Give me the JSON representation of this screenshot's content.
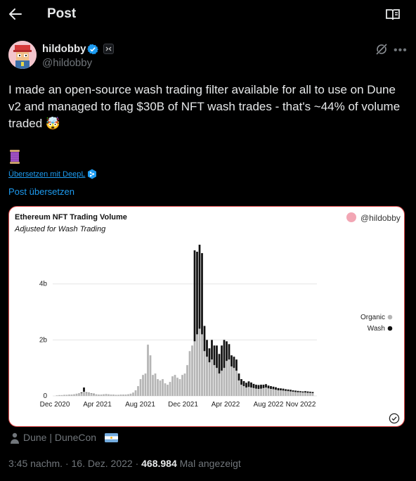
{
  "header": {
    "title": "Post"
  },
  "author": {
    "name": "hildobby",
    "handle": "@hildobby"
  },
  "tweet": {
    "text": "I made an open-source wash trading filter available for all to use on Dune v2 and managed to flag $30B of NFT wash trades - that's ~44% of volume traded 🤯",
    "deepl_link": "Übersetzen mit DeepL",
    "translate_link": "Post übersetzen"
  },
  "card": {
    "handle": "@hildobby"
  },
  "chart_data": {
    "type": "bar",
    "title": "Ethereum NFT Trading Volume",
    "subtitle": "Adjusted for Wash Trading",
    "stacked": true,
    "x_tick_labels": [
      "Dec 2020",
      "Apr 2021",
      "Aug 2021",
      "Dec 2021",
      "Apr 2022",
      "Aug 2022",
      "Nov 2022"
    ],
    "y_tick_labels": [
      "0",
      "2b",
      "4b"
    ],
    "ylim": [
      0,
      5500000000
    ],
    "grid": true,
    "legend": {
      "position": "right",
      "entries": [
        "Organic",
        "Wash"
      ]
    },
    "x": [
      "2020-12-07",
      "2020-12-14",
      "2020-12-21",
      "2020-12-28",
      "2021-01-04",
      "2021-01-11",
      "2021-01-18",
      "2021-01-25",
      "2021-02-01",
      "2021-02-08",
      "2021-02-15",
      "2021-02-22",
      "2021-03-01",
      "2021-03-08",
      "2021-03-15",
      "2021-03-22",
      "2021-03-29",
      "2021-04-05",
      "2021-04-12",
      "2021-04-19",
      "2021-04-26",
      "2021-05-03",
      "2021-05-10",
      "2021-05-17",
      "2021-05-24",
      "2021-05-31",
      "2021-06-07",
      "2021-06-14",
      "2021-06-21",
      "2021-06-28",
      "2021-07-05",
      "2021-07-12",
      "2021-07-19",
      "2021-07-26",
      "2021-08-02",
      "2021-08-09",
      "2021-08-16",
      "2021-08-23",
      "2021-08-30",
      "2021-09-06",
      "2021-09-13",
      "2021-09-20",
      "2021-09-27",
      "2021-10-04",
      "2021-10-11",
      "2021-10-18",
      "2021-10-25",
      "2021-11-01",
      "2021-11-08",
      "2021-11-15",
      "2021-11-22",
      "2021-11-29",
      "2021-12-06",
      "2021-12-13",
      "2021-12-20",
      "2021-12-27",
      "2022-01-03",
      "2022-01-10",
      "2022-01-17",
      "2022-01-24",
      "2022-01-31",
      "2022-02-07",
      "2022-02-14",
      "2022-02-21",
      "2022-02-28",
      "2022-03-07",
      "2022-03-14",
      "2022-03-21",
      "2022-03-28",
      "2022-04-04",
      "2022-04-11",
      "2022-04-18",
      "2022-04-25",
      "2022-05-02",
      "2022-05-09",
      "2022-05-16",
      "2022-05-23",
      "2022-05-30",
      "2022-06-06",
      "2022-06-13",
      "2022-06-20",
      "2022-06-27",
      "2022-07-04",
      "2022-07-11",
      "2022-07-18",
      "2022-07-25",
      "2022-08-01",
      "2022-08-08",
      "2022-08-15",
      "2022-08-22",
      "2022-08-29",
      "2022-09-05",
      "2022-09-12",
      "2022-09-19",
      "2022-09-26",
      "2022-10-03",
      "2022-10-10",
      "2022-10-17",
      "2022-10-24",
      "2022-10-31",
      "2022-11-07",
      "2022-11-14",
      "2022-11-21",
      "2022-11-28",
      "2022-12-05"
    ],
    "series": [
      {
        "name": "Organic",
        "color": "#b5b5b5",
        "values": [
          0.02,
          0.03,
          0.03,
          0.04,
          0.04,
          0.05,
          0.05,
          0.06,
          0.08,
          0.1,
          0.1,
          0.15,
          0.12,
          0.1,
          0.08,
          0.07,
          0.06,
          0.05,
          0.05,
          0.06,
          0.07,
          0.06,
          0.05,
          0.05,
          0.04,
          0.04,
          0.05,
          0.05,
          0.05,
          0.06,
          0.08,
          0.12,
          0.2,
          0.35,
          0.6,
          0.75,
          0.8,
          1.83,
          1.45,
          0.75,
          0.8,
          0.6,
          0.55,
          0.6,
          0.45,
          0.4,
          0.5,
          0.7,
          0.75,
          0.65,
          0.6,
          0.75,
          0.8,
          1.1,
          1.6,
          1.8,
          1.95,
          2.2,
          2.4,
          2.2,
          1.6,
          1.4,
          1.2,
          1.3,
          1.1,
          1.0,
          0.8,
          0.9,
          1.0,
          1.25,
          1.3,
          1.05,
          1.0,
          0.9,
          0.55,
          0.4,
          0.35,
          0.3,
          0.32,
          0.3,
          0.28,
          0.26,
          0.25,
          0.26,
          0.28,
          0.3,
          0.27,
          0.25,
          0.24,
          0.22,
          0.2,
          0.2,
          0.19,
          0.18,
          0.17,
          0.16,
          0.15,
          0.14,
          0.13,
          0.13,
          0.12,
          0.12,
          0.11,
          0.11,
          0.1
        ]
      },
      {
        "name": "Wash",
        "color": "#111111",
        "values": [
          0,
          0,
          0,
          0,
          0,
          0,
          0,
          0,
          0,
          0,
          0.02,
          0.15,
          0.01,
          0.01,
          0.01,
          0.01,
          0,
          0,
          0,
          0,
          0,
          0,
          0,
          0,
          0,
          0,
          0,
          0,
          0,
          0,
          0,
          0,
          0,
          0,
          0,
          0,
          0,
          0,
          0,
          0,
          0,
          0,
          0,
          0,
          0,
          0,
          0,
          0,
          0,
          0,
          0,
          0,
          0,
          0,
          0,
          0,
          3.25,
          2.95,
          3.0,
          2.9,
          0.9,
          0.6,
          0.5,
          0.7,
          0.7,
          0.8,
          0.7,
          0.9,
          1.0,
          0.7,
          0.55,
          0.4,
          0.4,
          0.4,
          0.25,
          0.2,
          0.18,
          0.17,
          0.2,
          0.18,
          0.15,
          0.14,
          0.14,
          0.14,
          0.12,
          0.12,
          0.1,
          0.1,
          0.09,
          0.09,
          0.08,
          0.07,
          0.07,
          0.06,
          0.06,
          0.06,
          0.05,
          0.05,
          0.05,
          0.04,
          0.04,
          0.05,
          0.05,
          0.04,
          0.04
        ]
      }
    ]
  },
  "location": {
    "text": "Dune | DuneCon"
  },
  "meta": {
    "time": "3:45 nachm.",
    "date": "16. Dez. 2022",
    "views": "468.984",
    "views_label": "Mal angezeigt"
  }
}
